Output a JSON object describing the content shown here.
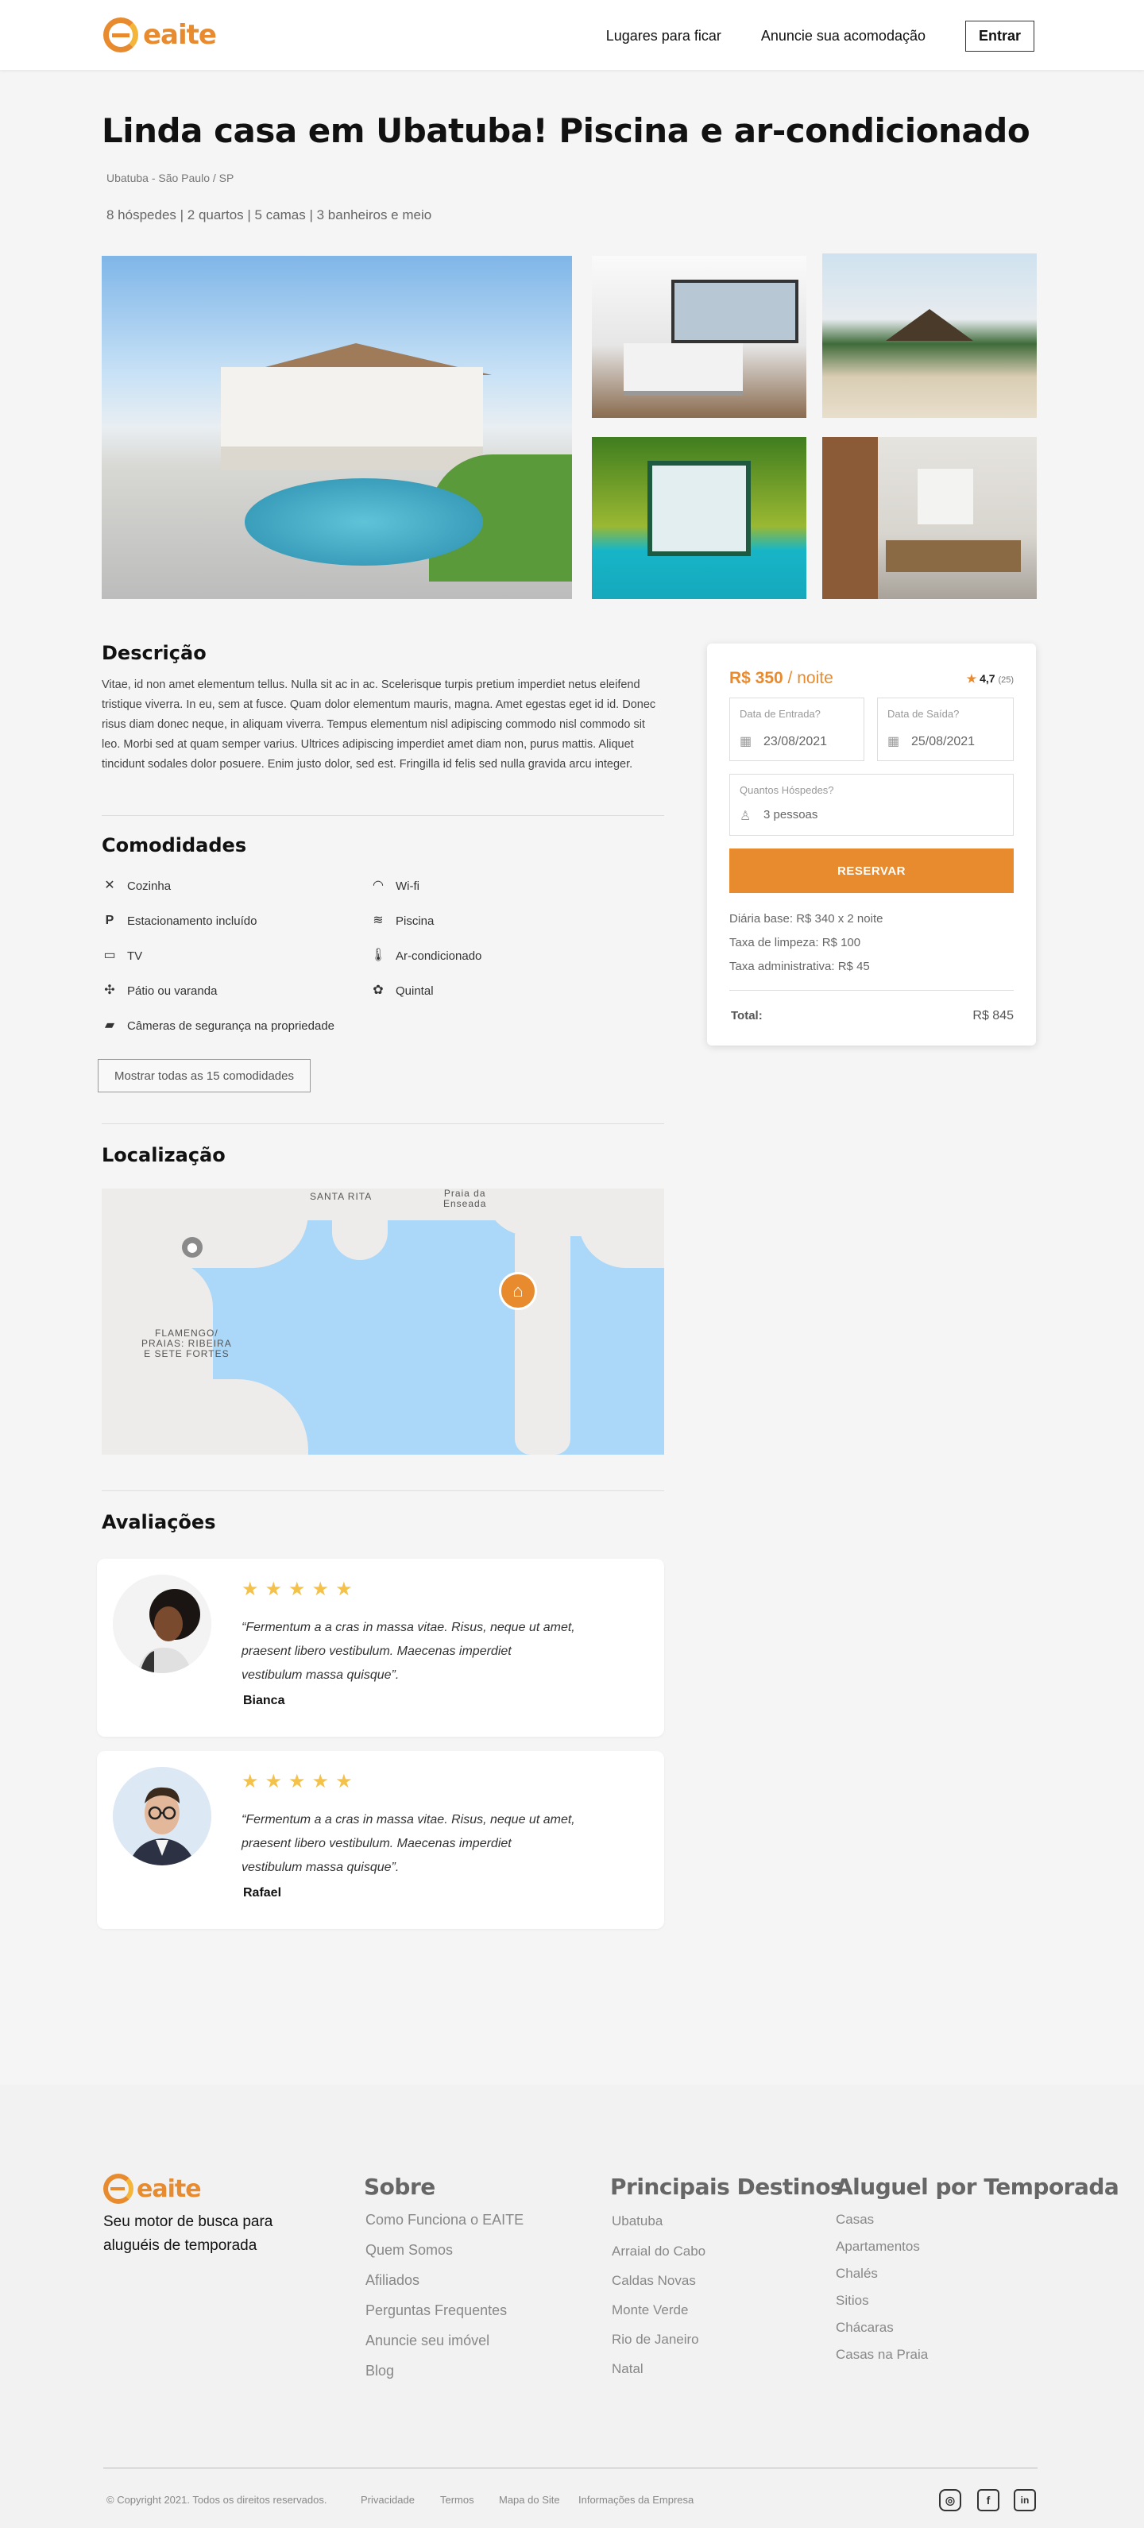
{
  "header": {
    "brand": "eaite",
    "nav": [
      "Lugares para ficar",
      "Anuncie sua acomodação"
    ],
    "login": "Entrar"
  },
  "listing": {
    "title": "Linda casa em Ubatuba! Piscina e ar-condicionado",
    "location": "Ubatuba - São Paulo / SP",
    "specs": "8 hóspedes | 2 quartos | 5 camas | 3 banheiros e meio"
  },
  "description": {
    "heading": "Descrição",
    "text": "Vitae, id non amet elementum tellus. Nulla sit ac in ac. Scelerisque turpis pretium imperdiet netus eleifend tristique viverra. In eu, sem at fusce. Quam dolor elementum mauris, magna. Amet egestas eget id id. Donec risus diam donec neque, in aliquam viverra. Tempus elementum nisl adipiscing commodo nisl commodo sit leo. Morbi sed at quam semper varius. Ultrices adipiscing imperdiet amet diam non, purus mattis. Aliquet tincidunt sodales dolor posuere. Enim justo dolor, sed est. Fringilla id felis sed nulla gravida arcu integer."
  },
  "amenities": {
    "heading": "Comodidades",
    "items": [
      {
        "label": "Cozinha",
        "icon": "utensils-icon"
      },
      {
        "label": "Wi-fi",
        "icon": "wifi-icon"
      },
      {
        "label": "Estacionamento incluído",
        "icon": "parking-icon"
      },
      {
        "label": "Piscina",
        "icon": "pool-icon"
      },
      {
        "label": "TV",
        "icon": "tv-icon"
      },
      {
        "label": "Ar-condicionado",
        "icon": "thermometer-icon"
      },
      {
        "label": "Pátio ou varanda",
        "icon": "patio-icon"
      },
      {
        "label": "Quintal",
        "icon": "garden-icon"
      },
      {
        "label": "Câmeras de segurança na propriedade",
        "icon": "camera-icon"
      }
    ],
    "show_all": "Mostrar todas as 15 comodidades"
  },
  "location": {
    "heading": "Localização",
    "labels": {
      "santa_rita": "SANTA RITA",
      "praia": "Praia da\nEnseada",
      "flamengo": "FLAMENGO/\nPRAIAS: RIBEIRA\nE SETE FORTES"
    }
  },
  "reviews": {
    "heading": "Avaliações",
    "items": [
      {
        "name": "Bianca",
        "stars": "★★★★★",
        "text": "“Fermentum a a cras in massa vitae. Risus, neque ut amet, praesent libero vestibulum. Maecenas imperdiet vestibulum massa quisque”."
      },
      {
        "name": "Rafael",
        "stars": "★★★★★",
        "text": "“Fermentum a a cras in massa vitae. Risus, neque ut amet, praesent libero vestibulum. Maecenas imperdiet vestibulum massa quisque”."
      }
    ]
  },
  "booking": {
    "price": "R$ 350",
    "per": " / noite",
    "rating": "4,7",
    "rating_count": "(25)",
    "checkin_label": "Data de Entrada?",
    "checkin_value": "23/08/2021",
    "checkout_label": "Data de Saída?",
    "checkout_value": "25/08/2021",
    "guests_label": "Quantos Hóspedes?",
    "guests_value": "3 pessoas",
    "reserve": "RESERVAR",
    "fees": [
      "Diária base: R$ 340 x 2 noite",
      "Taxa de limpeza: R$ 100",
      "Taxa administrativa: R$ 45"
    ],
    "total_label": "Total:",
    "total_value": "R$ 845"
  },
  "footer": {
    "brand": "eaite",
    "tagline": "Seu motor de busca para aluguéis de temporada",
    "columns": [
      {
        "title": "Sobre",
        "links": [
          "Como Funciona o EAITE",
          "Quem Somos",
          "Afiliados",
          "Perguntas Frequentes",
          "Anuncie seu imóvel",
          "Blog"
        ]
      },
      {
        "title": "Principais Destinos",
        "links": [
          "Ubatuba",
          "Arraial do Cabo",
          "Caldas Novas",
          "Monte Verde",
          "Rio de Janeiro",
          "Natal"
        ]
      },
      {
        "title": "Aluguel por Temporada",
        "links": [
          "Casas",
          "Apartamentos",
          "Chalés",
          "Sitios",
          "Chácaras",
          "Casas na Praia"
        ]
      }
    ],
    "copyright": "© Copyright 2021. Todos os direitos reservados.",
    "bottom_links": [
      "Privacidade",
      "Termos",
      "Mapa do Site",
      "Informações da Empresa"
    ]
  },
  "colors": {
    "accent": "#e88b2e",
    "star": "#f4c24a"
  }
}
